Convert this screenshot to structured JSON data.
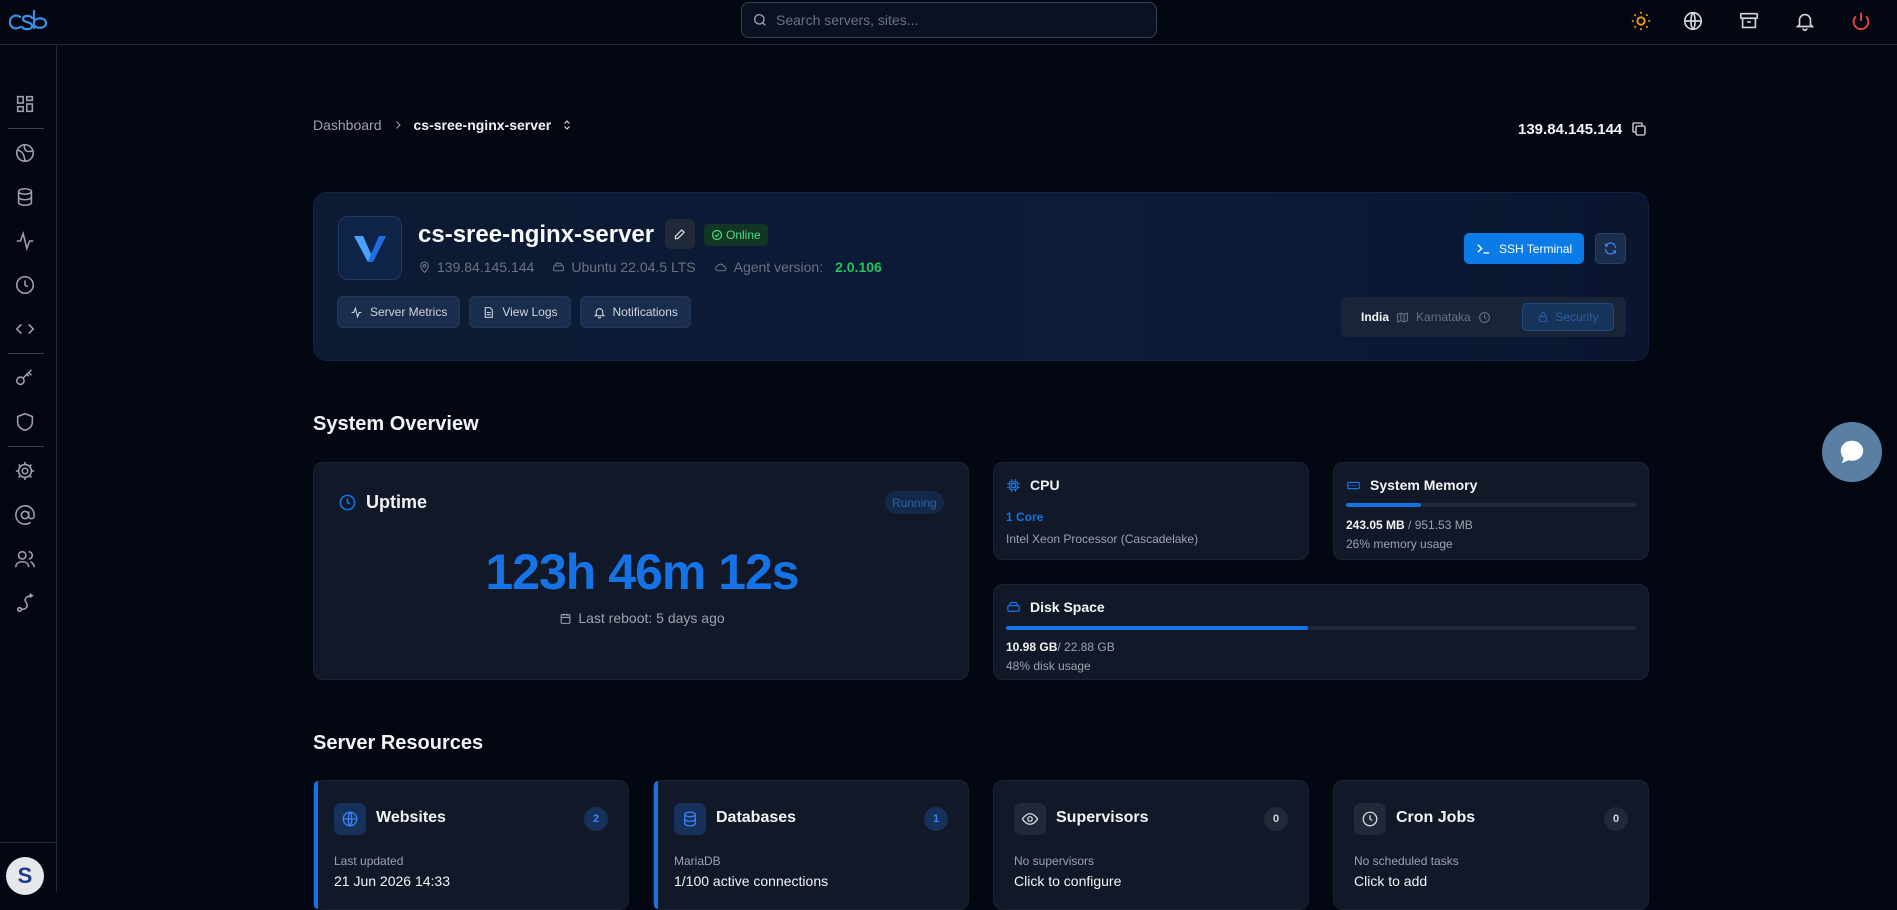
{
  "topbar": {
    "logo_text": "cSb",
    "search_placeholder": "Search servers, sites...",
    "icons": [
      "sun-icon",
      "globe-icon",
      "archive-icon",
      "bell-icon",
      "power-icon"
    ]
  },
  "sidebar": {
    "icons": [
      "dashboard-icon",
      "globe-network-icon",
      "database-icon",
      "activity-icon",
      "clock-icon",
      "code-icon",
      "key-icon",
      "shield-icon",
      "settings-icon",
      "at-icon",
      "users-icon",
      "route-icon"
    ],
    "avatar_initial": "S"
  },
  "breadcrumb": {
    "root": "Dashboard",
    "current": "cs-sree-nginx-server"
  },
  "header_ip": "139.84.145.144",
  "server": {
    "name": "cs-sree-nginx-server",
    "status": "Online",
    "ip": "139.84.145.144",
    "os": "Ubuntu 22.04.5 LTS",
    "agent_label": "Agent version:",
    "agent_version": "2.0.106",
    "buttons": {
      "metrics": "Server Metrics",
      "logs": "View Logs",
      "notifications": "Notifications"
    },
    "ssh_label": "SSH Terminal",
    "location": {
      "country": "India",
      "state": "Karnataka",
      "security": "Security"
    }
  },
  "overview": {
    "title": "System Overview",
    "uptime": {
      "title": "Uptime",
      "status": "Running",
      "value": "123h 46m 12s",
      "reboot": "Last reboot: 5 days ago"
    },
    "cpu": {
      "title": "CPU",
      "cores": "1 Core",
      "model": "Intel Xeon Processor (Cascadelake)"
    },
    "memory": {
      "title": "System Memory",
      "used": "243.05 MB",
      "total": " / 951.53 MB",
      "usage": "26% memory usage",
      "percent": 26
    },
    "disk": {
      "title": "Disk Space",
      "used": "10.98 GB",
      "total": "/ 22.88 GB",
      "usage": "48% disk usage",
      "percent": 48
    }
  },
  "resources": {
    "title": "Server Resources",
    "items": [
      {
        "title": "Websites",
        "count": "2",
        "sub": "Last updated",
        "value": "21 Jun 2026 14:33"
      },
      {
        "title": "Databases",
        "count": "1",
        "sub": "MariaDB",
        "value": "1/100 active connections"
      },
      {
        "title": "Supervisors",
        "count": "0",
        "sub": "No supervisors",
        "value": "Click to configure"
      },
      {
        "title": "Cron Jobs",
        "count": "0",
        "sub": "No scheduled tasks",
        "value": "Click to add"
      }
    ]
  },
  "colors": {
    "accent": "#1673e6",
    "online": "#4ade80",
    "agent_version": "#22c55e",
    "background": "#030712",
    "card": "#111827"
  }
}
